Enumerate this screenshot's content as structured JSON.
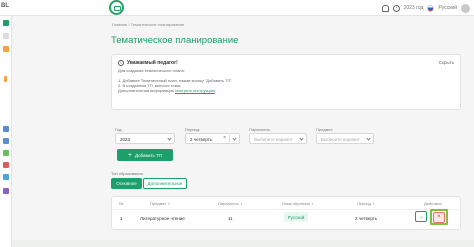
{
  "header": {
    "brand": "BL",
    "year": "2023 год",
    "language": "Русский"
  },
  "breadcrumbs": [
    "Главная",
    "Тематическое планирование"
  ],
  "page": {
    "title": "Тематическое планирование"
  },
  "notice": {
    "title": "Уважаемый педагог!",
    "collapse": "Скрыть",
    "lines": [
      "Для создания тематического плана:",
      "1. Добавьте Тематический план, нажав кнопку \"Добавить ТП\"",
      "2. В созданном ТП, внесите темы."
    ],
    "more_prefix": "Дополнительная информация",
    "more_link": "смотреть инструкцию"
  },
  "filters": {
    "year": {
      "label": "Год:",
      "value": "2023"
    },
    "period": {
      "label": "Период:",
      "value": "2 четверть"
    },
    "parallel": {
      "label": "Параллель:",
      "placeholder": "Выберите вариант"
    },
    "subject": {
      "label": "Предмет:",
      "placeholder": "Выберите вариант"
    }
  },
  "add_button": "Добавить ТП",
  "education": {
    "label": "Тип образования",
    "tabs": [
      "Основное",
      "Дополнительное"
    ]
  },
  "table": {
    "columns": [
      "№",
      "Предмет",
      "Параллель",
      "Язык обучения",
      "Период",
      "Действия"
    ],
    "rows": [
      {
        "num": "1",
        "subject": "Литературное чтение",
        "parallel": "11",
        "language": "Русский",
        "period": "2 четверть"
      }
    ]
  },
  "colors": {
    "accent": "#1d9e6a",
    "delete": "#d32f2f",
    "highlight": "#7dc242"
  }
}
